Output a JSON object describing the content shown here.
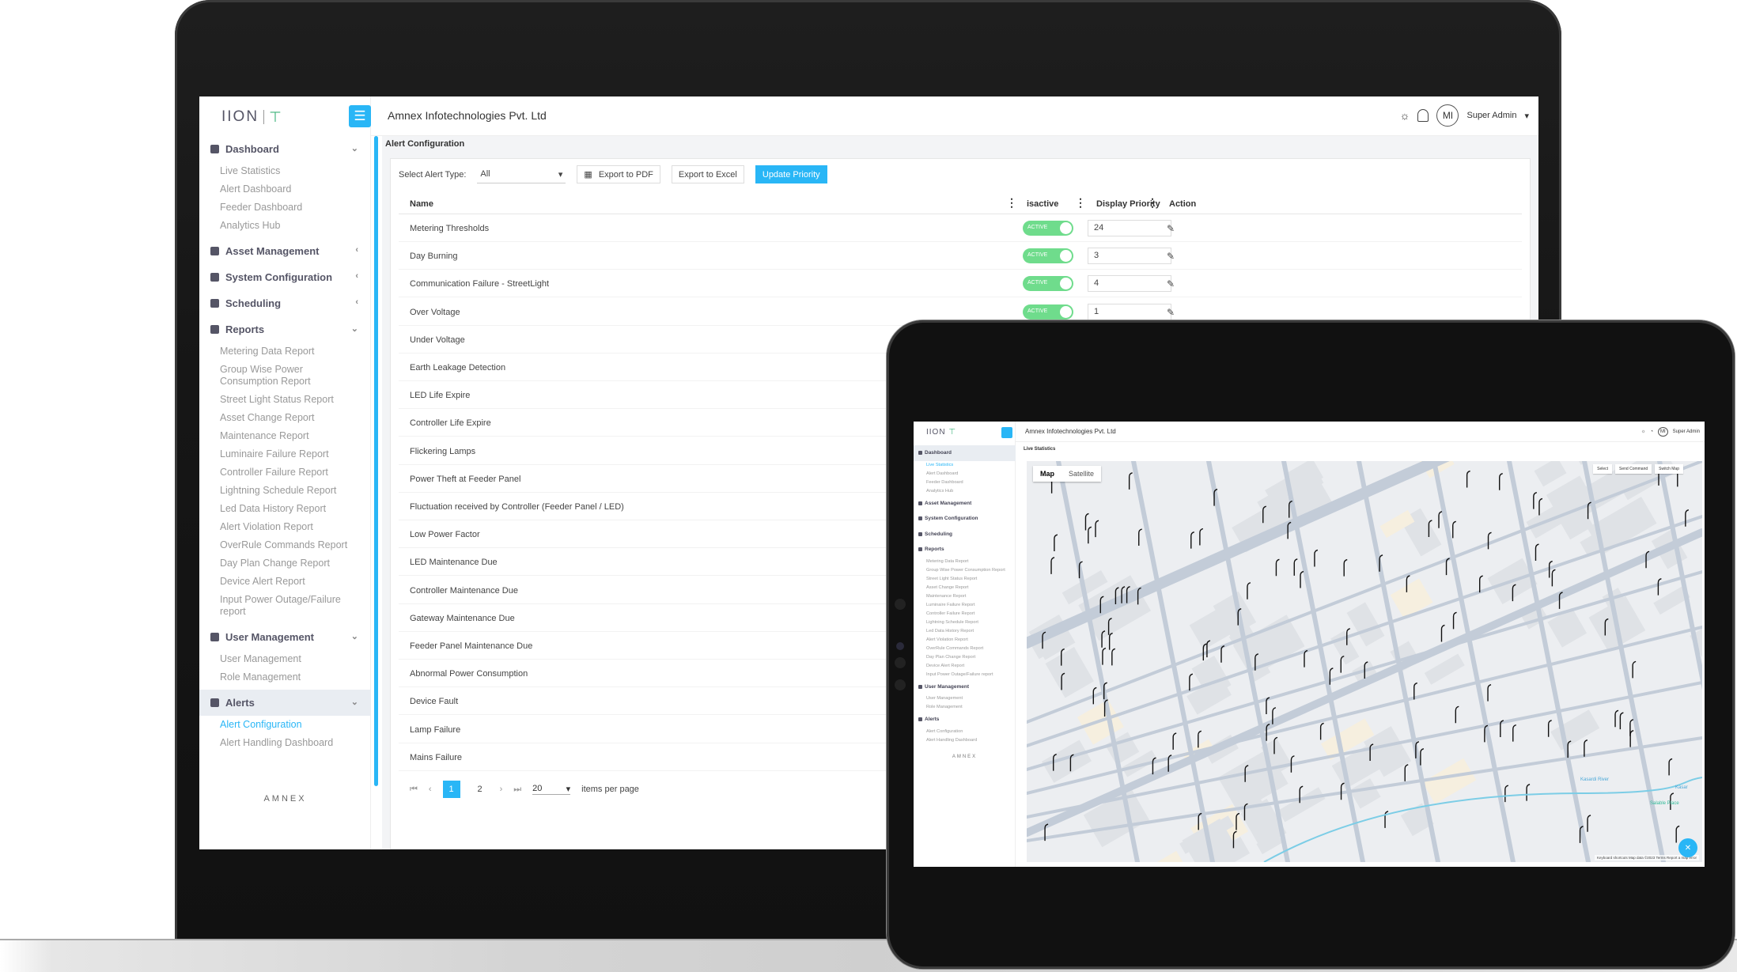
{
  "laptop": {
    "brand": "IION",
    "company": "Amnex Infotechnologies Pvt. Ltd",
    "avatar": "MI",
    "user": "Super Admin",
    "footer_logo": "AMNEX",
    "sidebar": [
      {
        "label": "Dashboard",
        "items": [
          "Live Statistics",
          "Alert Dashboard",
          "Feeder Dashboard",
          "Analytics Hub"
        ]
      },
      {
        "label": "Asset Management",
        "items": []
      },
      {
        "label": "System Configuration",
        "items": []
      },
      {
        "label": "Scheduling",
        "items": []
      },
      {
        "label": "Reports",
        "items": [
          "Metering Data Report",
          "Group Wise Power Consumption Report",
          "Street Light Status Report",
          "Asset Change Report",
          "Maintenance Report",
          "Luminaire Failure Report",
          "Controller Failure Report",
          "Lightning Schedule Report",
          "Led Data History Report",
          "Alert Violation Report",
          "OverRule Commands Report",
          "Day Plan Change Report",
          "Device Alert Report",
          "Input Power Outage/Failure report"
        ]
      },
      {
        "label": "User Management",
        "items": [
          "User Management",
          "Role Management"
        ]
      },
      {
        "label": "Alerts",
        "items": [
          "Alert Configuration",
          "Alert Handling Dashboard"
        ]
      }
    ],
    "page_title": "Alert Configuration",
    "toolbar": {
      "select_label": "Select Alert Type:",
      "select_value": "All",
      "export_pdf": "Export to PDF",
      "export_excel": "Export to Excel",
      "update_priority": "Update Priority"
    },
    "table": {
      "headers": {
        "name": "Name",
        "isactive": "isactive",
        "priority": "Display Priority",
        "action": "Action"
      },
      "toggle_label": "ACTIVE",
      "rows": [
        {
          "name": "Metering Thresholds",
          "priority": "24"
        },
        {
          "name": "Day Burning",
          "priority": "3"
        },
        {
          "name": "Communication Failure - StreetLight",
          "priority": "4"
        },
        {
          "name": "Over Voltage",
          "priority": "1"
        },
        {
          "name": "Under Voltage"
        },
        {
          "name": "Earth Leakage Detection"
        },
        {
          "name": "LED Life Expire"
        },
        {
          "name": "Controller Life Expire"
        },
        {
          "name": "Flickering Lamps"
        },
        {
          "name": "Power Theft at Feeder Panel"
        },
        {
          "name": "Fluctuation received by Controller (Feeder Panel / LED)"
        },
        {
          "name": "Low Power Factor"
        },
        {
          "name": "LED Maintenance Due"
        },
        {
          "name": "Controller Maintenance Due"
        },
        {
          "name": "Gateway Maintenance Due"
        },
        {
          "name": "Feeder Panel Maintenance Due"
        },
        {
          "name": "Abnormal Power Consumption"
        },
        {
          "name": "Device Fault"
        },
        {
          "name": "Lamp Failure"
        },
        {
          "name": "Mains Failure"
        }
      ]
    },
    "pager": {
      "pages": [
        "1",
        "2"
      ],
      "per_page": "20",
      "per_page_label": "items per page"
    }
  },
  "tablet": {
    "brand": "IION",
    "company": "Amnex Infotechnologies Pvt. Ltd",
    "user": "Super Admin",
    "avatar": "MI",
    "page_title": "Live Statistics",
    "map_tabs": [
      "Map",
      "Satellite"
    ],
    "map_controls": [
      "Select",
      "Send Command",
      "Switch Map"
    ],
    "map_labels": {
      "river": "Kasardi River",
      "place": "Salable Place",
      "kasar": "Kasar"
    },
    "map_footer": "Keyboard shortcuts   Map data ©2023   Terms   Report a map error",
    "footer_logo": "AMNEX",
    "sidebar": [
      {
        "label": "Dashboard",
        "items": [
          "Live Statistics",
          "Alert Dashboard",
          "Feeder Dashboard",
          "Analytics Hub"
        ]
      },
      {
        "label": "Asset Management",
        "items": []
      },
      {
        "label": "System Configuration",
        "items": []
      },
      {
        "label": "Scheduling",
        "items": []
      },
      {
        "label": "Reports",
        "items": [
          "Metering Data Report",
          "Group Wise Power Consumption Report",
          "Street Light Status Report",
          "Asset Change Report",
          "Maintenance Report",
          "Luminaire Failure Report",
          "Controller Failure Report",
          "Lightning Schedule Report",
          "Led Data History Report",
          "Alert Violation Report",
          "OverRule Commands Report",
          "Day Plan Change Report",
          "Device Alert Report",
          "Input Power Outage/Failure report"
        ]
      },
      {
        "label": "User Management",
        "items": [
          "User Management",
          "Role Management"
        ]
      },
      {
        "label": "Alerts",
        "items": [
          "Alert Configuration",
          "Alert Handling Dashboard"
        ]
      }
    ]
  },
  "colors": {
    "accent": "#29b6f6",
    "toggle": "#6fdc8c",
    "device": "#141414"
  }
}
